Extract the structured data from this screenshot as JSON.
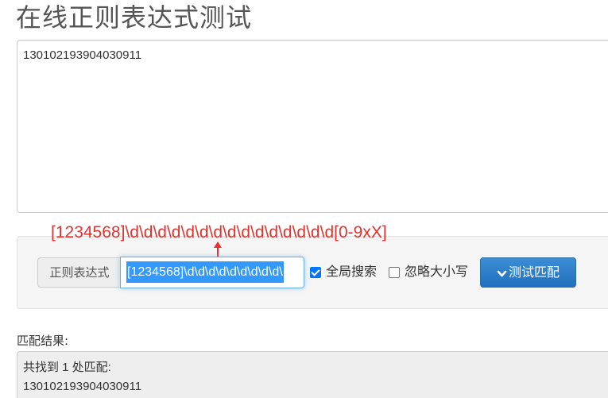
{
  "page": {
    "title": "在线正则表达式测试"
  },
  "source": {
    "text": "130102193904030911"
  },
  "annotation": {
    "text": "[1234568]\\d\\d\\d\\d\\d\\d\\d\\d\\d\\d\\d\\d\\d\\d\\d[0-9xX]",
    "color": "#e8302c"
  },
  "toolbar": {
    "regex_label": "正则表达式",
    "regex_value": "[1234568]\\d\\d\\d\\d\\d\\d\\d\\d\\d\\",
    "global_label": "全局搜索",
    "global_checked": true,
    "ignore_case_label": "忽略大小写",
    "ignore_case_checked": false,
    "test_button_label": "测试匹配",
    "button_color": "#2a7bc8"
  },
  "result": {
    "label": "匹配结果:",
    "summary": "共找到 1 处匹配:",
    "matches": [
      "130102193904030911"
    ]
  }
}
